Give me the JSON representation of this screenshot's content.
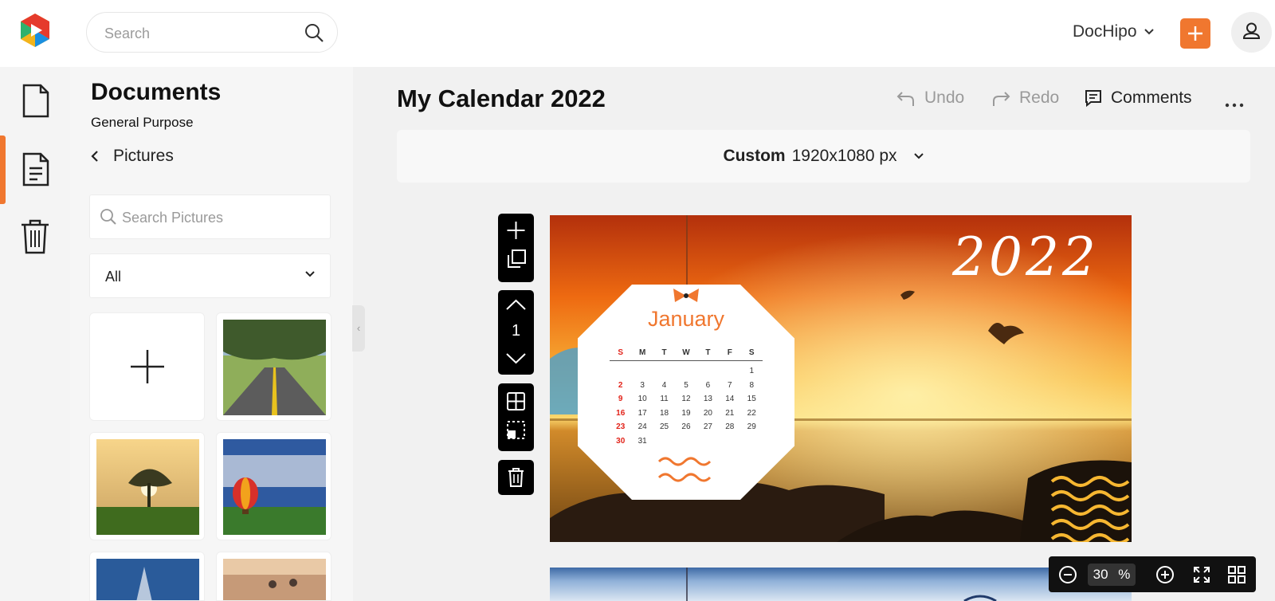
{
  "app": {
    "logo_icon": "dochipo-play-logo"
  },
  "header": {
    "search_placeholder": "Search",
    "team_name": "DocHipo",
    "accent_color": "#f0772f"
  },
  "rail": {
    "items": [
      {
        "name": "document-icon",
        "active": false
      },
      {
        "name": "documents-list-icon",
        "active": true
      },
      {
        "name": "trash-icon",
        "active": false
      }
    ]
  },
  "panel": {
    "title": "Documents",
    "subtitle": "General Purpose",
    "back_label": "Pictures",
    "search_placeholder": "Search Pictures",
    "filter_value": "All"
  },
  "editor": {
    "doc_title": "My Calendar 2022",
    "undo_label": "Undo",
    "redo_label": "Redo",
    "comments_label": "Comments",
    "size_name": "Custom",
    "size_value": "1920x1080 px",
    "page_number": "1",
    "zoom_value": "30",
    "zoom_unit": "%"
  },
  "calendar": {
    "year": "2022",
    "month": "January",
    "weekdays": [
      "S",
      "M",
      "T",
      "W",
      "T",
      "F",
      "S"
    ],
    "rows": [
      [
        "",
        "",
        "",
        "",
        "",
        "",
        "1"
      ],
      [
        "2",
        "3",
        "4",
        "5",
        "6",
        "7",
        "8"
      ],
      [
        "9",
        "10",
        "11",
        "12",
        "13",
        "14",
        "15"
      ],
      [
        "16",
        "17",
        "18",
        "19",
        "20",
        "21",
        "22"
      ],
      [
        "23",
        "24",
        "25",
        "26",
        "27",
        "28",
        "29"
      ],
      [
        "30",
        "31",
        "",
        "",
        "",
        "",
        ""
      ]
    ],
    "sunday_color": "#e2231a",
    "month_color": "#f0772f"
  }
}
